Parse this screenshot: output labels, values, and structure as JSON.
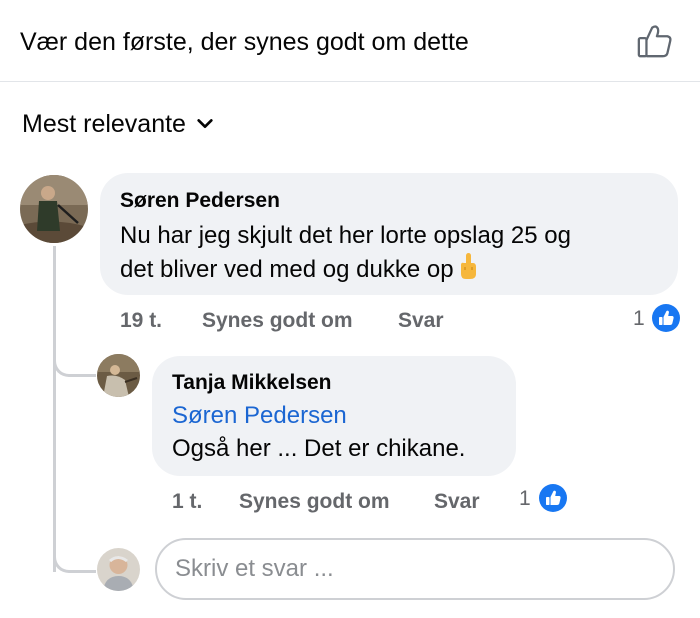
{
  "header": {
    "title": "Vær den første, der synes godt om dette",
    "like_icon": "thumbs-up-outline-icon"
  },
  "sort": {
    "label": "Mest relevante",
    "icon": "chevron-down-icon"
  },
  "comments": [
    {
      "author": "Søren Pedersen",
      "text_line1": "Nu har jeg skjult det her lorte opslag 25 og",
      "text_line2": "det bliver ved med og dukke op",
      "emoji": "middle-finger-emoji",
      "time": "19 t.",
      "like_label": "Synes godt om",
      "reply_label": "Svar",
      "reaction_count": "1"
    },
    {
      "author": "Tanja Mikkelsen",
      "mention": "Søren Pedersen",
      "text": "Også her ... Det er chikane.",
      "time": "1 t.",
      "like_label": "Synes godt om",
      "reply_label": "Svar",
      "reaction_count": "1"
    }
  ],
  "reply_box": {
    "placeholder": "Skriv et svar ..."
  },
  "colors": {
    "bubble": "#f0f2f5",
    "link": "#1b66d2",
    "like_blue": "#1877f2",
    "meta_gray": "#65676b",
    "thread_line": "#ced0d4"
  }
}
